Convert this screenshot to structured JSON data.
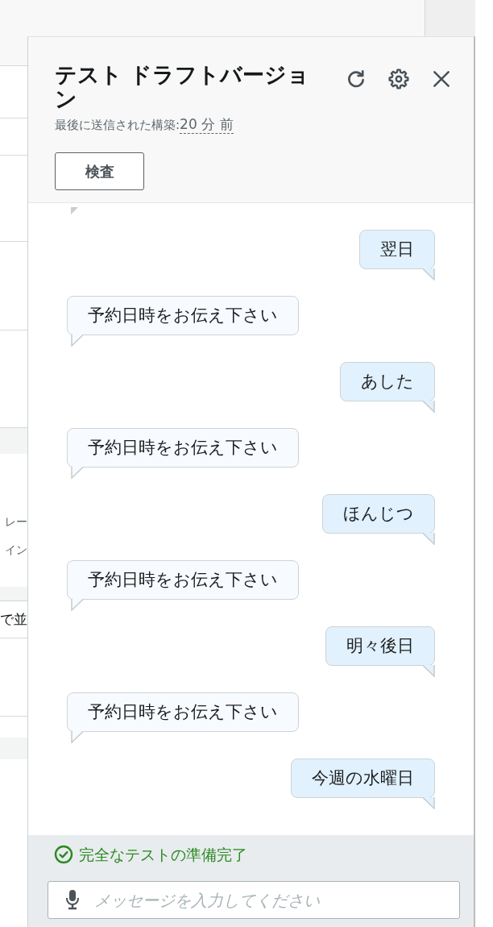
{
  "background_page": {
    "row_1_lines": [
      "レー",
      "イン"
    ],
    "row_2_text": "で並"
  },
  "panel": {
    "title": "テスト ドラフトバージョン",
    "subtitle": "最後に送信された構築:",
    "time": "20 分 前",
    "button": "検査"
  },
  "messages": [
    {
      "kind": "sent",
      "text": "翌日"
    },
    {
      "kind": "received",
      "text": "予約日時をお伝え下さい"
    },
    {
      "kind": "sent",
      "text": "あした"
    },
    {
      "kind": "received",
      "text": "予約日時をお伝え下さい"
    },
    {
      "kind": "sent",
      "text": "ほんじつ"
    },
    {
      "kind": "received",
      "text": "予約日時をお伝え下さい"
    },
    {
      "kind": "sent",
      "text": "明々後日"
    },
    {
      "kind": "received",
      "text": "予約日時をお伝え下さい"
    },
    {
      "kind": "sent",
      "text": "今週の水曜日"
    }
  ],
  "status": {
    "text": "完全なテストの準備完了"
  },
  "input": {
    "placeholder": "メッセージを入力してください"
  }
}
